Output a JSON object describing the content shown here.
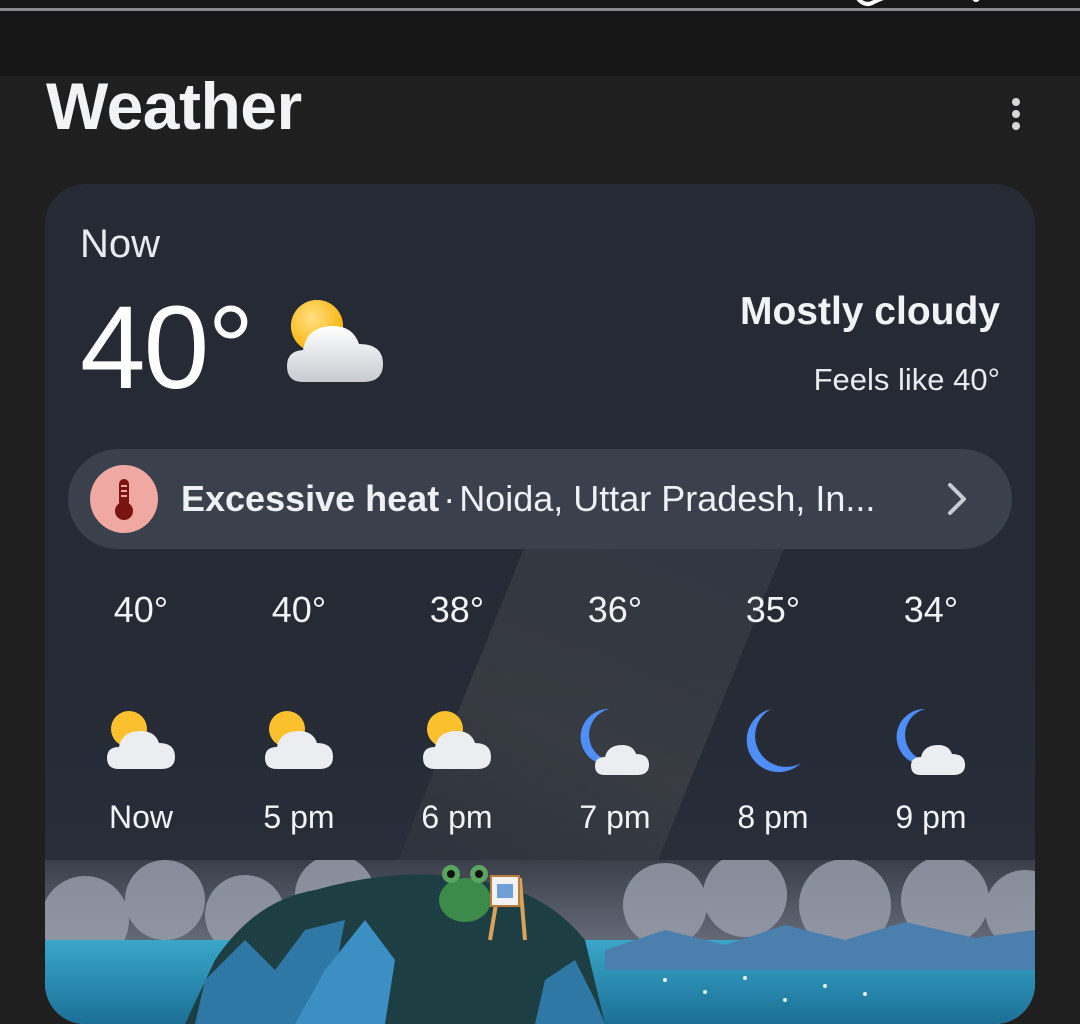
{
  "header": {
    "title": "Weather"
  },
  "current": {
    "label": "Now",
    "temperature": "40°",
    "icon": "mostly-cloudy-day-icon",
    "condition": "Mostly cloudy",
    "feels_like": "Feels like 40°"
  },
  "alert": {
    "icon": "thermometer-icon",
    "title": "Excessive heat",
    "separator": "·",
    "location": "Noida, Uttar Pradesh, In..."
  },
  "hourly": [
    {
      "temp": "40°",
      "label": "Now",
      "icon": "mostly-cloudy-day-icon"
    },
    {
      "temp": "40°",
      "label": "5 pm",
      "icon": "mostly-cloudy-day-icon"
    },
    {
      "temp": "38°",
      "label": "6 pm",
      "icon": "mostly-cloudy-day-icon"
    },
    {
      "temp": "36°",
      "label": "7 pm",
      "icon": "partly-cloudy-night-icon"
    },
    {
      "temp": "35°",
      "label": "8 pm",
      "icon": "clear-night-icon"
    },
    {
      "temp": "34°",
      "label": "9 pm",
      "icon": "partly-cloudy-night-icon"
    }
  ],
  "colors": {
    "card": "#262a35",
    "alert_bg": "#3b404d",
    "alert_badge": "#f0a8a2",
    "sun": "#fbc02d",
    "moon": "#4f8ef7"
  }
}
